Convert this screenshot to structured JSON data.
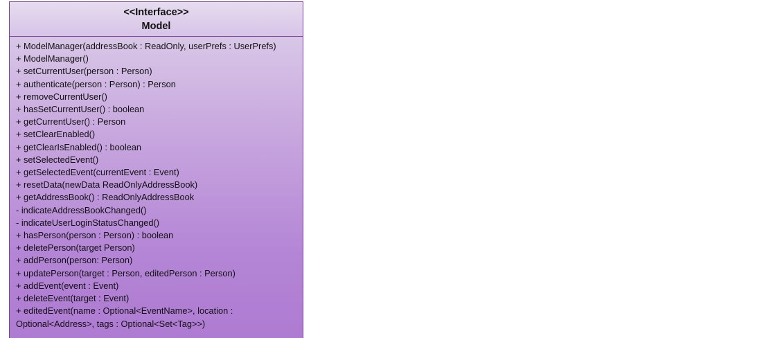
{
  "diagram": {
    "stereotype": "<<Interface>>",
    "class_name": "Model",
    "colors": {
      "border": "#7a3fa0",
      "fill_top": "#ded2ea",
      "fill_bottom": "#ae7bd2"
    },
    "methods": [
      "+ ModelManager(addressBook : ReadOnly, userPrefs : UserPrefs)",
      "+ ModelManager()",
      "+ setCurrentUser(person : Person)",
      "+ authenticate(person : Person) : Person",
      "+ removeCurrentUser()",
      "+ hasSetCurrentUser() : boolean",
      "+ getCurrentUser() : Person",
      "+ setClearEnabled()",
      "+ getClearIsEnabled() : boolean",
      "+ setSelectedEvent()",
      "+ getSelectedEvent(currentEvent : Event)",
      "+ resetData(newData ReadOnlyAddressBook)",
      "+ getAddressBook() : ReadOnlyAddressBook",
      "- indicateAddressBookChanged()",
      "- indicateUserLoginStatusChanged()",
      "+ hasPerson(person : Person) : boolean",
      "+ deletePerson(target Person)",
      "+ addPerson(person: Person)",
      "+ updatePerson(target : Person, editedPerson : Person)",
      "+ addEvent(event : Event)",
      "+ deleteEvent(target : Event)",
      "+ editedEvent(name : Optional<EventName>, location : Optional<Address>, tags : Optional<Set<Tag>>)"
    ]
  }
}
